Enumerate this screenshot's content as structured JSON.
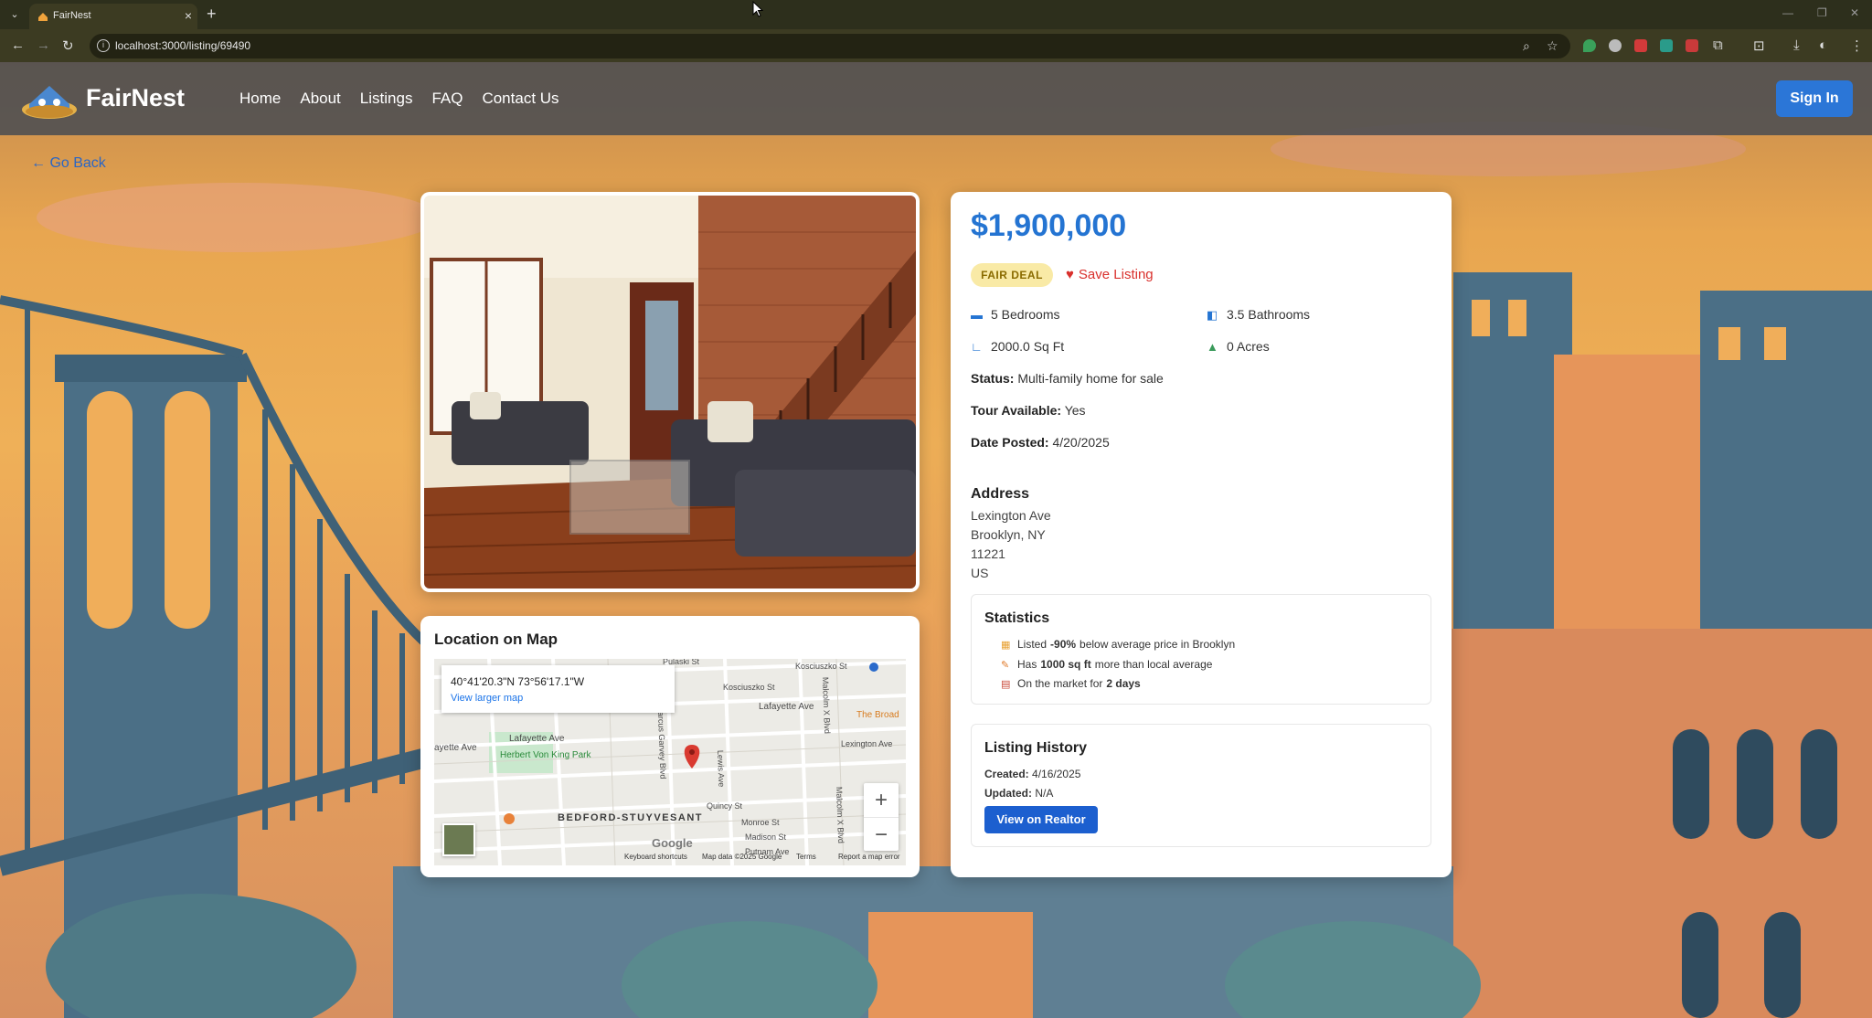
{
  "browser": {
    "tab_title": "FairNest",
    "url": "localhost:3000/listing/69490",
    "tab_close": "×",
    "new_tab": "+"
  },
  "nav": {
    "brand": "FairNest",
    "links": [
      "Home",
      "About",
      "Listings",
      "FAQ",
      "Contact Us"
    ],
    "sign_in": "Sign In"
  },
  "go_back": "← Go Back",
  "listing": {
    "price": "$1,900,000",
    "badge": "FAIR DEAL",
    "save": "Save Listing",
    "bedrooms": "5 Bedrooms",
    "bathrooms": "3.5 Bathrooms",
    "sqft": "2000.0 Sq Ft",
    "acres": "0 Acres",
    "status_label": "Status:",
    "status_value": "Multi-family home for sale",
    "tour_label": "Tour Available:",
    "tour_value": "Yes",
    "date_label": "Date Posted:",
    "date_value": "4/20/2025"
  },
  "address": {
    "heading": "Address",
    "street": "Lexington Ave",
    "city": "Brooklyn, NY",
    "zip": "11221",
    "country": "US"
  },
  "statistics": {
    "heading": "Statistics",
    "s1_pre": "Listed",
    "s1_val": "-90%",
    "s1_post": "below average price in Brooklyn",
    "s2_pre": "Has",
    "s2_val": "1000 sq ft",
    "s2_post": "more than local average",
    "s3_pre": "On the market for",
    "s3_val": "2 days"
  },
  "history": {
    "heading": "Listing History",
    "created_label": "Created:",
    "created_value": "4/16/2025",
    "updated_label": "Updated:",
    "updated_value": "N/A",
    "button": "View on Realtor"
  },
  "map": {
    "title": "Location on Map",
    "coords": "40°41'20.3\"N 73°56'17.1\"W",
    "larger_map": "View larger map",
    "zoom_in": "+",
    "zoom_out": "−",
    "google": "Google",
    "footer": [
      "Keyboard shortcuts",
      "Map data ©2025 Google",
      "Terms",
      "Report a map error"
    ],
    "labels": {
      "pulaski": "Pulaski St",
      "kosciuszko": "Kosciuszko St",
      "kosciuszko2": "Kosciuszko St",
      "lafayette_r": "Lafayette Ave",
      "lafayette_l": "Lafayette Ave",
      "ayette": "ayette Ave",
      "park": "Herbert Von King Park",
      "marcus": "arcus Garvey Blvd",
      "lewis": "Lewis Ave",
      "quincy": "Quincy St",
      "malcolm": "Malcolm X Blvd",
      "malcolm2": "Malcolm X Blvd",
      "lexington": "Lexington Ave",
      "broad": "The Broad",
      "bedstuy": "BEDFORD-STUYVESANT",
      "monroe": "Monroe St",
      "madison": "Madison St",
      "putnam": "Putnam Ave"
    }
  },
  "colors": {
    "accent": "#2474d2",
    "badge_bg": "#f9eaa6",
    "save": "#d9302c",
    "realtor_button": "#1c5fcf"
  },
  "icons": {
    "bed": "bed-icon",
    "bath": "bath-icon",
    "area": "ruler-icon",
    "acres": "tree-icon",
    "heart": "heart-icon"
  }
}
